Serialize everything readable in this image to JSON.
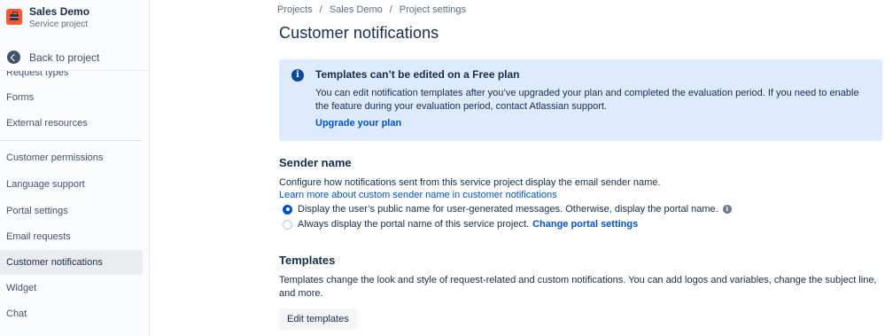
{
  "project": {
    "name": "Sales Demo",
    "type": "Service project",
    "brand_color": "#ff5630"
  },
  "sidebar": {
    "back_label": "Back to project",
    "cut_item": "Request types",
    "items": [
      {
        "label": "Forms"
      },
      {
        "label": "External resources"
      },
      {
        "label": "Customer permissions"
      },
      {
        "label": "Language support"
      },
      {
        "label": "Portal settings"
      },
      {
        "label": "Email requests"
      },
      {
        "label": "Customer notifications",
        "active": true
      },
      {
        "label": "Widget"
      },
      {
        "label": "Chat"
      }
    ]
  },
  "breadcrumb": [
    "Projects",
    "Sales Demo",
    "Project settings"
  ],
  "page_title": "Customer notifications",
  "notice": {
    "title": "Templates can’t be edited on a Free plan",
    "body": "You can edit notification templates after you’ve upgraded your plan and completed the evaluation period. If you need to enable the feature during your evaluation period, contact Atlassian support.",
    "link": "Upgrade your plan",
    "bg_color": "#deebff"
  },
  "sender": {
    "heading": "Sender name",
    "description": "Configure how notifications sent from this service project display the email sender name.",
    "learn_link": "Learn more about custom sender name in customer notifications",
    "options": [
      {
        "label": "Display the user’s public name for user-generated messages. Otherwise, display the portal name.",
        "checked": true
      },
      {
        "label": "Always display the portal name of this service project.",
        "link": "Change portal settings",
        "checked": false
      }
    ]
  },
  "templates": {
    "heading": "Templates",
    "description": "Templates change the look and style of request-related and custom notifications. You can add logos and variables, change the subject line, and more.",
    "button": "Edit templates"
  },
  "colors": {
    "link": "#0052cc",
    "radio_checked": "#0052cc",
    "text": "#172b4d"
  }
}
